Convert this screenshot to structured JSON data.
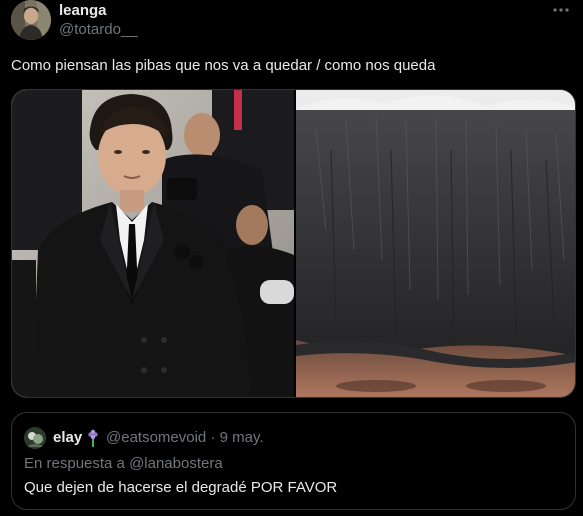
{
  "tweet": {
    "author": {
      "display_name": "leanga",
      "handle": "@totardo__"
    },
    "more_icon": "more-horizontal-icon",
    "text": "Como piensan las pibas que nos va a quedar / como nos queda",
    "media": [
      {
        "description": "man-in-black-suit-photo"
      },
      {
        "description": "close-up-hair-photo"
      }
    ]
  },
  "quote": {
    "display_name": "elay",
    "name_emoji": "hyacinth-icon",
    "handle_and_time": "@eatsomevoid · 9 may.",
    "reply_context": "En respuesta a @lanabostera",
    "text": "Que dejen de hacerse el degradé POR FAVOR"
  },
  "colors": {
    "background": "#000000",
    "primary_text": "#e7e9ea",
    "secondary_text": "#71767b",
    "border": "#2f3336"
  }
}
